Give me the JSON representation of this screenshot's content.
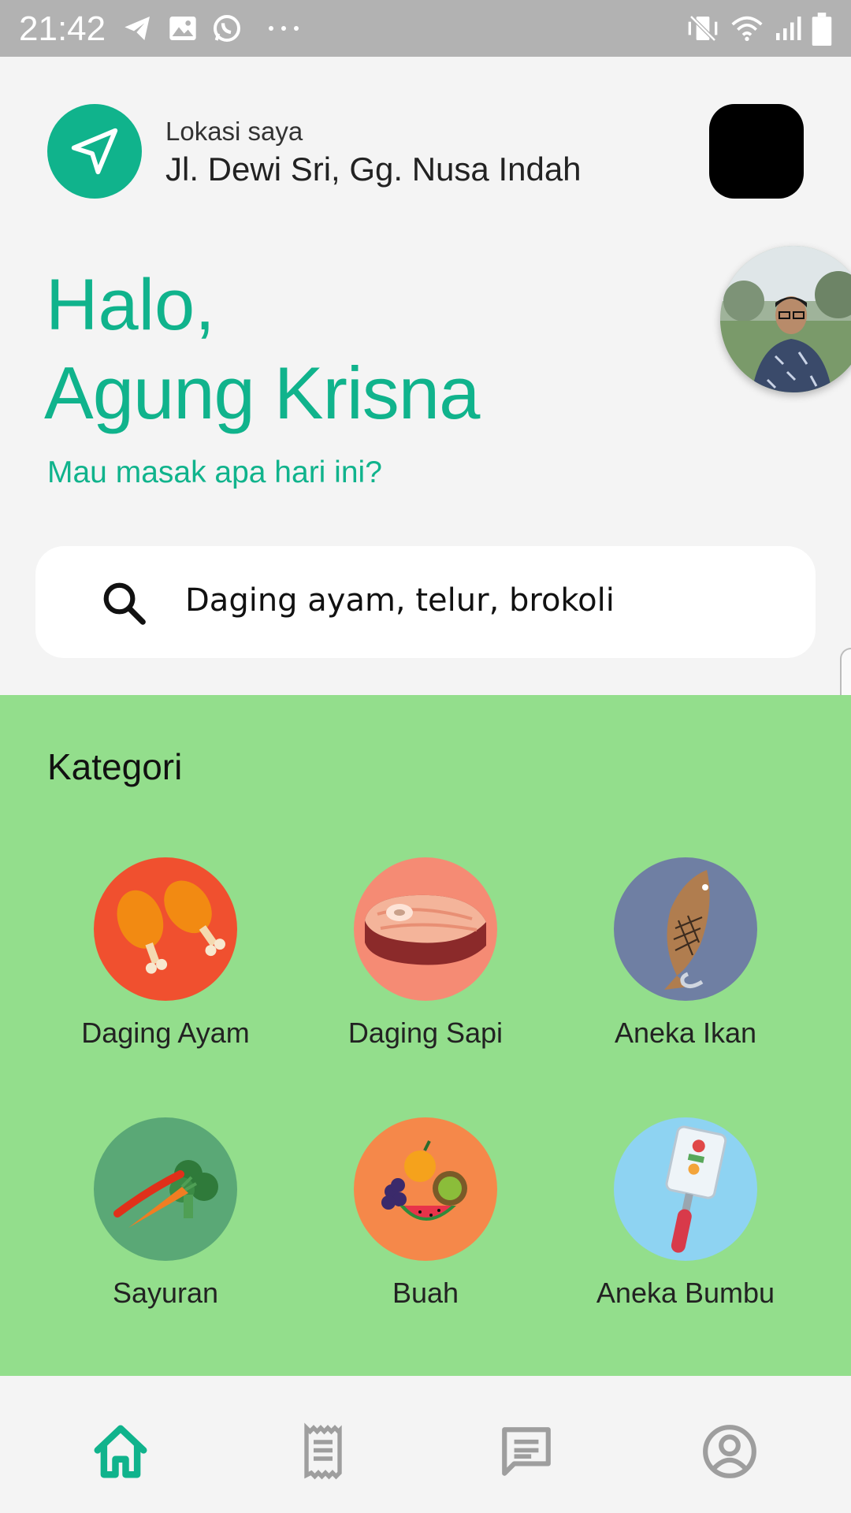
{
  "status_bar": {
    "time": "21:42"
  },
  "location": {
    "label": "Lokasi saya",
    "value": "Jl. Dewi Sri, Gg. Nusa Indah"
  },
  "greeting": {
    "hello": "Halo,",
    "name": "Agung Krisna",
    "subtitle": "Mau masak apa hari ini?"
  },
  "search": {
    "value": "Daging ayam, telur, brokoli"
  },
  "categories": {
    "title": "Kategori",
    "items": [
      {
        "label": "Daging Ayam",
        "icon": "chicken-drumstick-icon",
        "color": "#f0502f"
      },
      {
        "label": "Daging Sapi",
        "icon": "beef-steak-icon",
        "color": "#f58b74"
      },
      {
        "label": "Aneka Ikan",
        "icon": "fish-icon",
        "color": "#6f7fa3"
      },
      {
        "label": "Sayuran",
        "icon": "vegetables-icon",
        "color": "#5aa876"
      },
      {
        "label": "Buah",
        "icon": "fruits-icon",
        "color": "#f5884a"
      },
      {
        "label": "Aneka Bumbu",
        "icon": "spice-spatula-icon",
        "color": "#8ed3f2"
      }
    ]
  },
  "bottom_nav": {
    "items": [
      {
        "icon": "home-icon",
        "active": true
      },
      {
        "icon": "receipt-icon",
        "active": false
      },
      {
        "icon": "chat-icon",
        "active": false
      },
      {
        "icon": "profile-icon",
        "active": false
      }
    ]
  },
  "colors": {
    "accent": "#10b38c",
    "category_bg": "#93de8c",
    "inactive": "#9e9e9e"
  }
}
